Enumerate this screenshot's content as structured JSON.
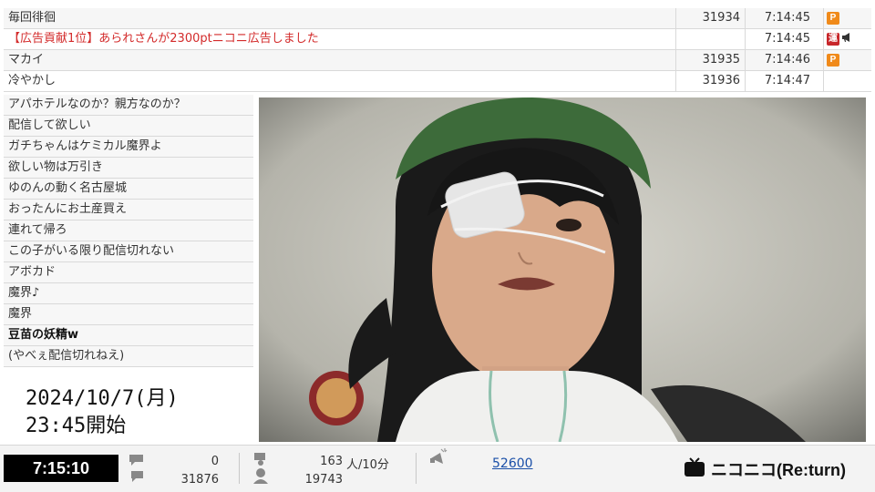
{
  "top_comments": [
    {
      "text": "毎回徘徊",
      "number": "31934",
      "time": "7:14:45",
      "badge": "P",
      "ad": false
    },
    {
      "text": "【広告貢献1位】あられさんが2300ptニコニ広告しました",
      "number": "",
      "time": "7:14:45",
      "badge": "運",
      "ad": true
    },
    {
      "text": "マカイ",
      "number": "31935",
      "time": "7:14:46",
      "badge": "P",
      "ad": false
    },
    {
      "text": "冷やかし",
      "number": "31936",
      "time": "7:14:47",
      "badge": "",
      "ad": false
    }
  ],
  "side_comments": [
    {
      "text": "アパホテルなのか？親方なのか？"
    },
    {
      "text": "配信して欲しい"
    },
    {
      "text": "ガチちゃんはケミカル魔界よ"
    },
    {
      "text": "欲しい物は万引き"
    },
    {
      "text": "ゆのんの動く名古屋城"
    },
    {
      "text": "おったんにお土産買え"
    },
    {
      "text": "連れて帰ろ"
    },
    {
      "text": "この子がいる限り配信切れない"
    },
    {
      "text": "アボカド"
    },
    {
      "text": "魔界♪"
    },
    {
      "text": "魔界"
    },
    {
      "text": "豆苗の妖精w"
    },
    {
      "text": "(やべぇ配信切れねえ)"
    }
  ],
  "date_overlay": {
    "line1": "2024/10/7(月)",
    "line2": "23:45開始"
  },
  "bottom_bar": {
    "elapsed_time": "7:15:10",
    "comments_top": "0",
    "comments_total": "31876",
    "viewers_rate": "163",
    "viewers_rate_unit": "人/10分",
    "viewers_total": "19743",
    "ad_points": "52600",
    "logo_text": "ニコニコ(Re:turn)"
  },
  "colors": {
    "ad_text": "#d32b2b",
    "badge_p": "#f08a1a",
    "badge_un": "#c8262a",
    "clock_bg": "#000000",
    "link": "#1a4fa8"
  }
}
